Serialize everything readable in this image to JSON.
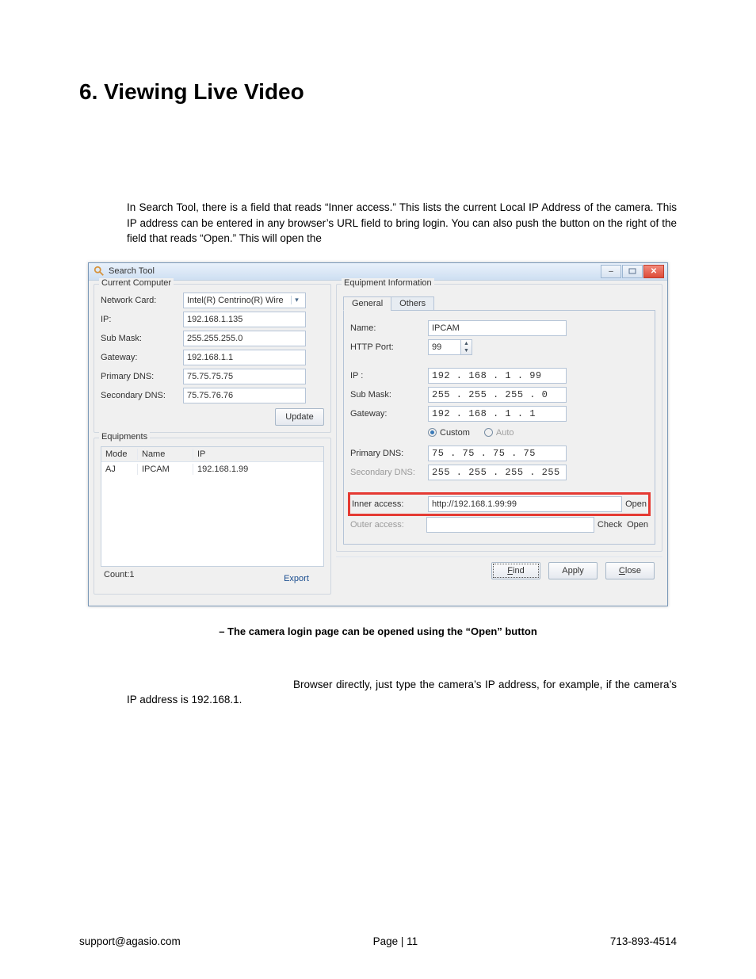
{
  "heading": "6. Viewing Live Video",
  "paragraph1": "In Search Tool, there is a field that reads “Inner access.” This lists the current Local IP Address of the camera. This IP address can be entered in any browser’s URL field to bring login. You can also push the button on the right of the field that reads “Open.” This will open the",
  "caption": "– The camera login page can be opened using the “Open” button",
  "paragraph2_lead": "Browser directly, just type the camera’s IP address, for example, if the camera’s IP address is 192.168.1.",
  "footer": {
    "email": "support@agasio.com",
    "page": "Page | 11",
    "phone": "713-893-4514"
  },
  "window": {
    "title": "Search Tool",
    "left": {
      "group_title": "Current Computer",
      "labels": {
        "nic": "Network Card:",
        "ip": "IP:",
        "mask": "Sub Mask:",
        "gw": "Gateway:",
        "pdns": "Primary DNS:",
        "sdns": "Secondary DNS:"
      },
      "values": {
        "nic": "Intel(R) Centrino(R) Wire",
        "ip": "192.168.1.135",
        "mask": "255.255.255.0",
        "gw": "192.168.1.1",
        "pdns": "75.75.75.75",
        "sdns": "75.75.76.76"
      },
      "update_btn": "Update",
      "equip_group": "Equipments",
      "cols": {
        "mode": "Mode",
        "name": "Name",
        "ip": "IP"
      },
      "row": {
        "mode": "AJ",
        "name": "IPCAM",
        "ip": "192.168.1.99"
      },
      "count_label": "Count:1",
      "export_btn": "Export"
    },
    "right": {
      "group_title": "Equipment Information",
      "tabs": {
        "general": "General",
        "others": "Others"
      },
      "labels": {
        "name": "Name:",
        "port": "HTTP Port:",
        "ip": "IP :",
        "mask": "Sub Mask:",
        "gw": "Gateway:",
        "pdns": "Primary DNS:",
        "sdns": "Secondary DNS:",
        "inner": "Inner access:",
        "outer": "Outer access:"
      },
      "values": {
        "name": "IPCAM",
        "port": "99",
        "ip": "192 . 168 .  1   .  99",
        "mask": "255 . 255 . 255 .  0",
        "gw": "192 . 168 .  1   .  1",
        "pdns": " 75  .  75 .  75 .  75",
        "sdns": "255 . 255 . 255 . 255",
        "inner": "http://192.168.1.99:99",
        "outer": ""
      },
      "radios": {
        "custom": "Custom",
        "auto": "Auto"
      },
      "link_open": "Open",
      "link_check": "Check",
      "bottom": {
        "find": "Find",
        "apply": "Apply",
        "close": "Close"
      }
    }
  }
}
